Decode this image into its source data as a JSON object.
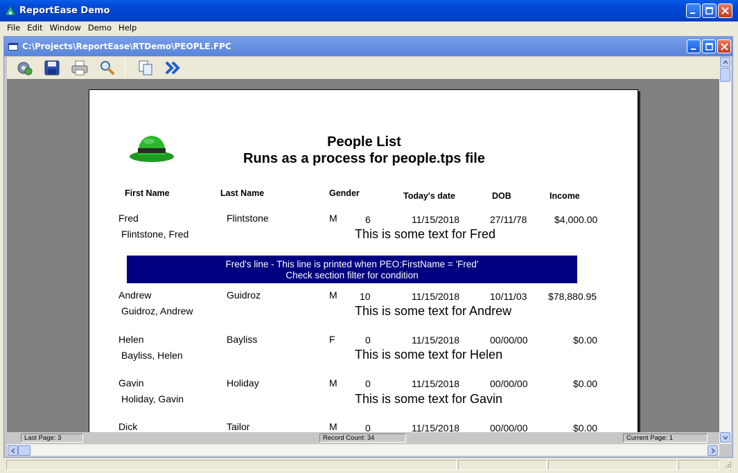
{
  "app": {
    "title": "ReportEase Demo",
    "accent": "#0044cc"
  },
  "menu": [
    "File",
    "Edit",
    "Window",
    "Demo",
    "Help"
  ],
  "child": {
    "title": "C:\\Projects\\ReportEase\\RTDemo\\PEOPLE.FPC"
  },
  "toolbar": {
    "icons": [
      "options-icon",
      "save-icon",
      "print-icon",
      "zoom-icon",
      "copy-icon",
      "next-page-icon"
    ]
  },
  "report": {
    "title": "People List",
    "subtitle": "Runs as a process for people.tps file",
    "columns": {
      "first": "First Name",
      "last": "Last Name",
      "gender": "Gender",
      "today": "Today's date",
      "dob": "DOB",
      "income": "Income"
    },
    "rows": [
      {
        "first": "Fred",
        "last": "Flintstone",
        "gender": "M",
        "num": "6",
        "today": "11/15/2018",
        "dob": "27/11/78",
        "income": "$4,000.00",
        "full": "Flintstone, Fred",
        "text": "This is some text for Fred"
      },
      {
        "first": "Andrew",
        "last": "Guidroz",
        "gender": "M",
        "num": "10",
        "today": "11/15/2018",
        "dob": "10/11/03",
        "income": "$78,880.95",
        "full": "Guidroz, Andrew",
        "text": "This is some text for Andrew"
      },
      {
        "first": "Helen",
        "last": "Bayliss",
        "gender": "F",
        "num": "0",
        "today": "11/15/2018",
        "dob": "00/00/00",
        "income": "$0.00",
        "full": "Bayliss, Helen",
        "text": "This is some text for Helen"
      },
      {
        "first": "Gavin",
        "last": "Holiday",
        "gender": "M",
        "num": "0",
        "today": "11/15/2018",
        "dob": "00/00/00",
        "income": "$0.00",
        "full": "Holiday, Gavin",
        "text": "This is some text for Gavin"
      },
      {
        "first": "Dick",
        "last": "Tailor",
        "gender": "M",
        "num": "0",
        "today": "11/15/2018",
        "dob": "00/00/00",
        "income": "$0.00"
      }
    ],
    "banner": {
      "line1": "Fred's line - This line is printed when PEO:FirstName = 'Fred'",
      "line2": "Check section filter for condition",
      "color": "#000080"
    }
  },
  "status": {
    "last_page": "Last Page: 3",
    "record_count": "Record Count: 34",
    "current_page": "Current Page: 1"
  }
}
